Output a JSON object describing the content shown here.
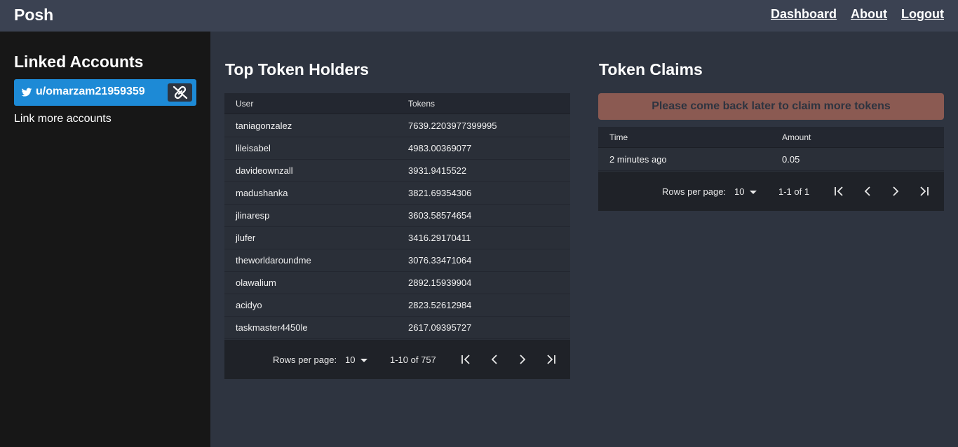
{
  "nav": {
    "brand": "Posh",
    "dashboard": "Dashboard",
    "about": "About",
    "logout": "Logout"
  },
  "sidebar": {
    "title": "Linked Accounts",
    "account": "u/omarzam21959359",
    "link_more": "Link more accounts"
  },
  "holders": {
    "title": "Top Token Holders",
    "headers": {
      "user": "User",
      "tokens": "Tokens"
    },
    "rows": [
      {
        "user": "taniagonzalez",
        "tokens": "7639.2203977399995"
      },
      {
        "user": "lileisabel",
        "tokens": "4983.00369077"
      },
      {
        "user": "davideownzall",
        "tokens": "3931.9415522"
      },
      {
        "user": "madushanka",
        "tokens": "3821.69354306"
      },
      {
        "user": "jlinaresp",
        "tokens": "3603.58574654"
      },
      {
        "user": "jlufer",
        "tokens": "3416.29170411"
      },
      {
        "user": "theworldaroundme",
        "tokens": "3076.33471064"
      },
      {
        "user": "olawalium",
        "tokens": "2892.15939904"
      },
      {
        "user": "acidyo",
        "tokens": "2823.52612984"
      },
      {
        "user": "taskmaster4450le",
        "tokens": "2617.09395727"
      }
    ],
    "rows_per_page_label": "Rows per page:",
    "rows_per_page": "10",
    "range": "1-10 of 757"
  },
  "claims": {
    "title": "Token Claims",
    "banner": "Please come back later to claim more tokens",
    "headers": {
      "time": "Time",
      "amount": "Amount"
    },
    "rows": [
      {
        "time": "2 minutes ago",
        "amount": "0.05"
      }
    ],
    "rows_per_page_label": "Rows per page:",
    "rows_per_page": "10",
    "range": "1-1 of 1"
  },
  "colors": {
    "navbar": "#3b4252",
    "sidebar": "#171717",
    "main": "#2e3440",
    "twitter": "#1d8ad6",
    "banner": "#8b5a52"
  },
  "icons": [
    "twitter-icon",
    "unlink-icon",
    "first-page-icon",
    "prev-page-icon",
    "next-page-icon",
    "last-page-icon",
    "caret-down-icon"
  ]
}
